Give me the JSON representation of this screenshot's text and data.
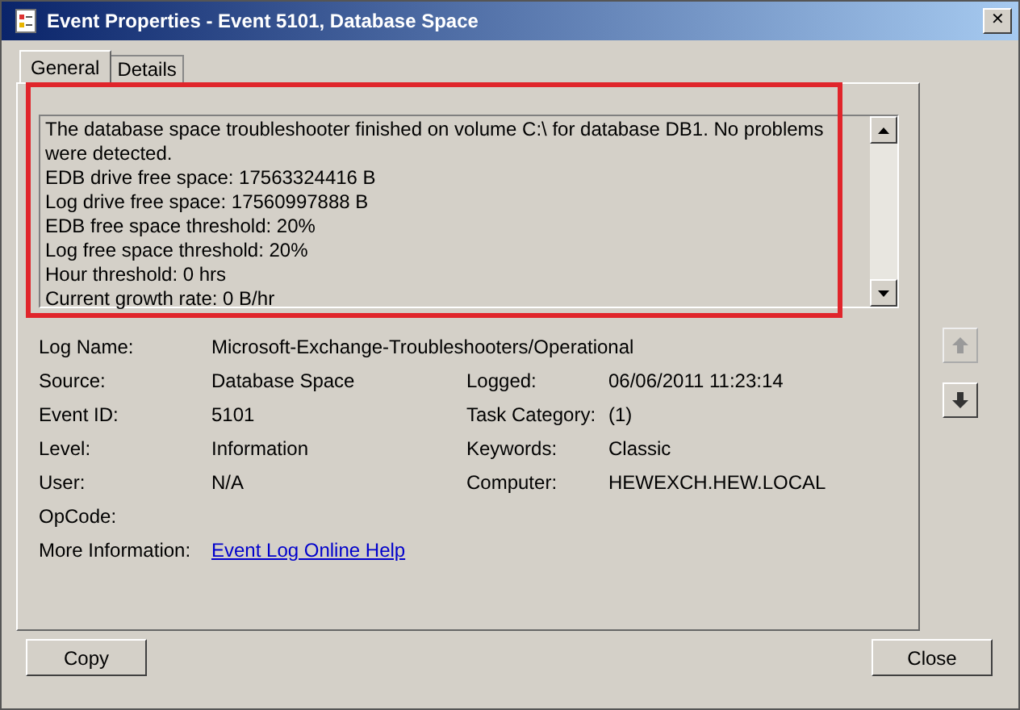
{
  "window": {
    "title": "Event Properties - Event 5101, Database Space",
    "close": "✕"
  },
  "tabs": [
    {
      "label": "General",
      "selected": true
    },
    {
      "label": "Details",
      "selected": false
    }
  ],
  "message": [
    "The database space troubleshooter finished on volume C:\\ for database DB1. No problems were detected.",
    "EDB drive free space: 17563324416 B",
    "Log drive free space: 17560997888 B",
    "EDB free space threshold: 20%",
    "Log free space threshold: 20%",
    "Hour threshold: 0 hrs",
    "Current growth rate: 0 B/hr"
  ],
  "fields": [
    {
      "label": "Log Name:",
      "value": "Microsoft-Exchange-Troubleshooters/Operational",
      "kind": "wide"
    },
    {
      "label": "Source:",
      "value": "Database Space",
      "label2": "Logged:",
      "value2": "06/06/2011 11:23:14",
      "kind": "pair"
    },
    {
      "label": "Event ID:",
      "value": "5101",
      "label2": "Task Category:",
      "value2": "(1)",
      "kind": "pair"
    },
    {
      "label": "Level:",
      "value": "Information",
      "label2": "Keywords:",
      "value2": "Classic",
      "kind": "pair"
    },
    {
      "label": "User:",
      "value": "N/A",
      "label2": "Computer:",
      "value2": "HEWEXCH.HEW.LOCAL",
      "kind": "pair"
    },
    {
      "label": "OpCode:",
      "kind": "label"
    },
    {
      "label": "More Information:",
      "value": "Event Log Online Help",
      "kind": "link"
    }
  ],
  "buttons": [
    {
      "label": "Copy"
    },
    {
      "label": "Close"
    }
  ]
}
